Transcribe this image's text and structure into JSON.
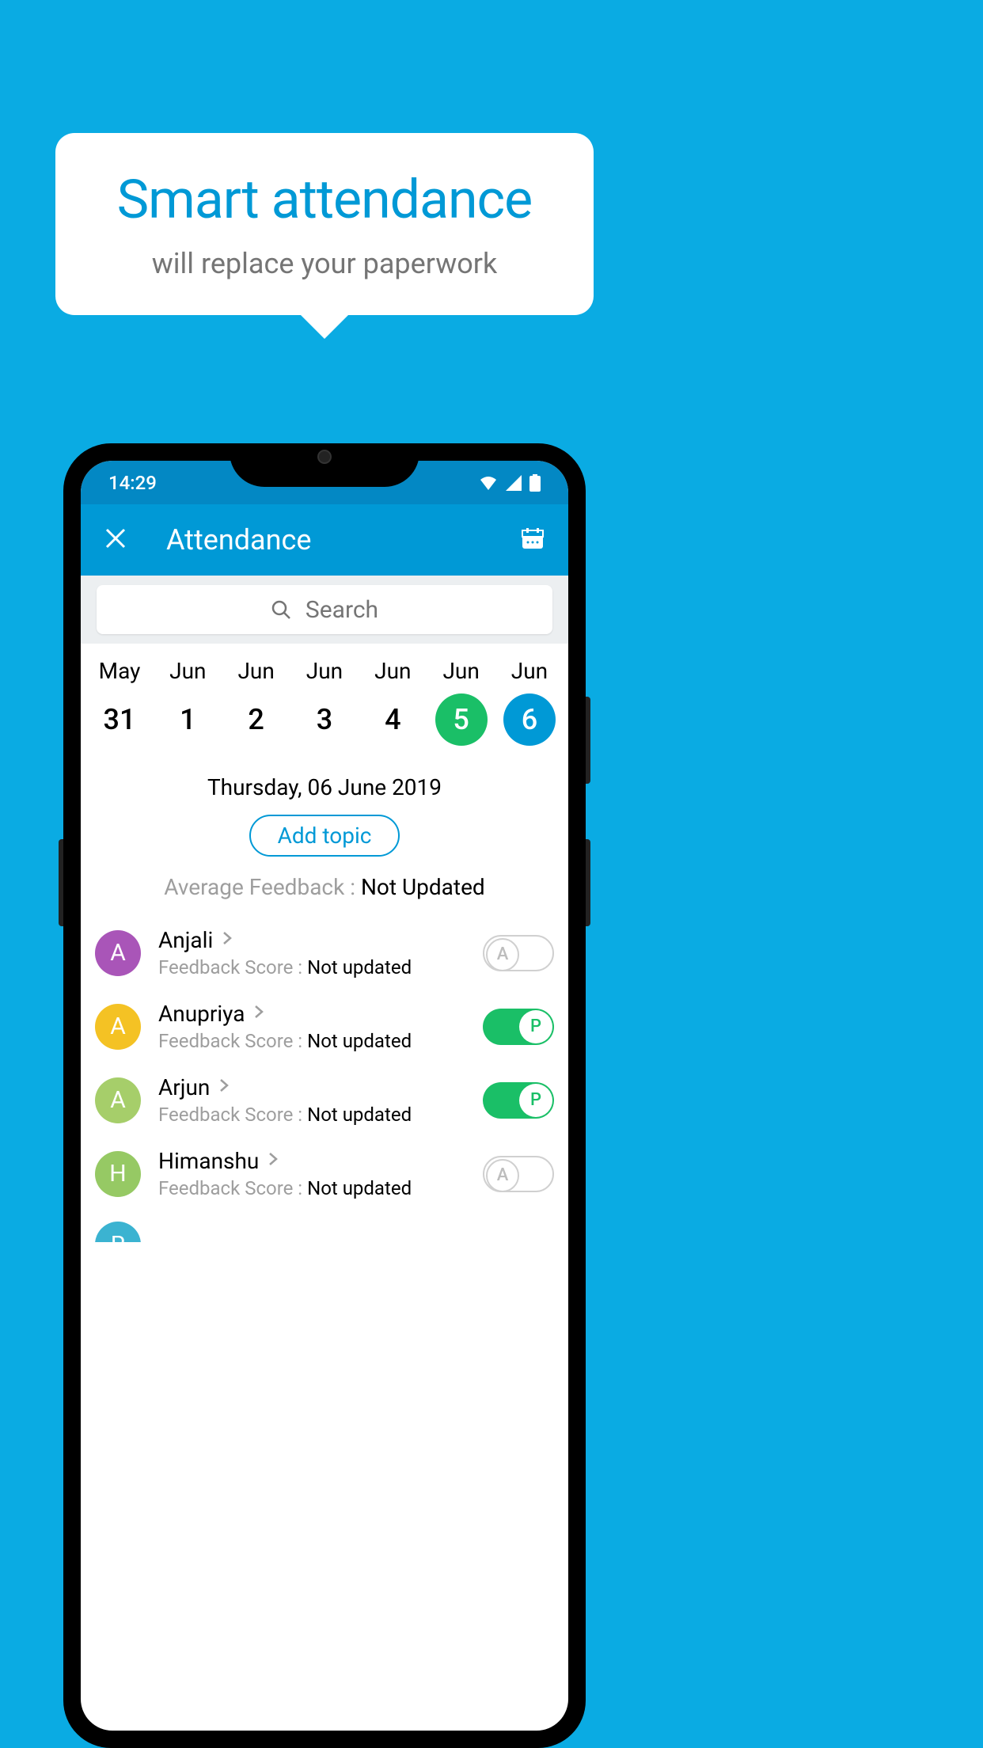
{
  "promo": {
    "title": "Smart attendance",
    "subtitle": "will replace your paperwork"
  },
  "status": {
    "time": "14:29"
  },
  "header": {
    "title": "Attendance"
  },
  "search": {
    "placeholder": "Search"
  },
  "dates": [
    {
      "month": "May",
      "day": "31",
      "state": "normal"
    },
    {
      "month": "Jun",
      "day": "1",
      "state": "normal"
    },
    {
      "month": "Jun",
      "day": "2",
      "state": "normal"
    },
    {
      "month": "Jun",
      "day": "3",
      "state": "normal"
    },
    {
      "month": "Jun",
      "day": "4",
      "state": "normal"
    },
    {
      "month": "Jun",
      "day": "5",
      "state": "green"
    },
    {
      "month": "Jun",
      "day": "6",
      "state": "blue"
    }
  ],
  "selected_date": "Thursday, 06 June 2019",
  "add_topic_label": "Add topic",
  "avg_feedback": {
    "label": "Average Feedback : ",
    "value": "Not Updated"
  },
  "students": [
    {
      "name": "Anjali",
      "initial": "A",
      "color": "#a955b8",
      "feedback_label": "Feedback Score : ",
      "feedback_value": "Not updated",
      "status": "A"
    },
    {
      "name": "Anupriya",
      "initial": "A",
      "color": "#f4c224",
      "feedback_label": "Feedback Score : ",
      "feedback_value": "Not updated",
      "status": "P"
    },
    {
      "name": "Arjun",
      "initial": "A",
      "color": "#a6ce6a",
      "feedback_label": "Feedback Score : ",
      "feedback_value": "Not updated",
      "status": "P"
    },
    {
      "name": "Himanshu",
      "initial": "H",
      "color": "#96c964",
      "feedback_label": "Feedback Score : ",
      "feedback_value": "Not updated",
      "status": "A"
    }
  ],
  "partial_student": {
    "initial": "R",
    "color": "#3bb3d1"
  }
}
